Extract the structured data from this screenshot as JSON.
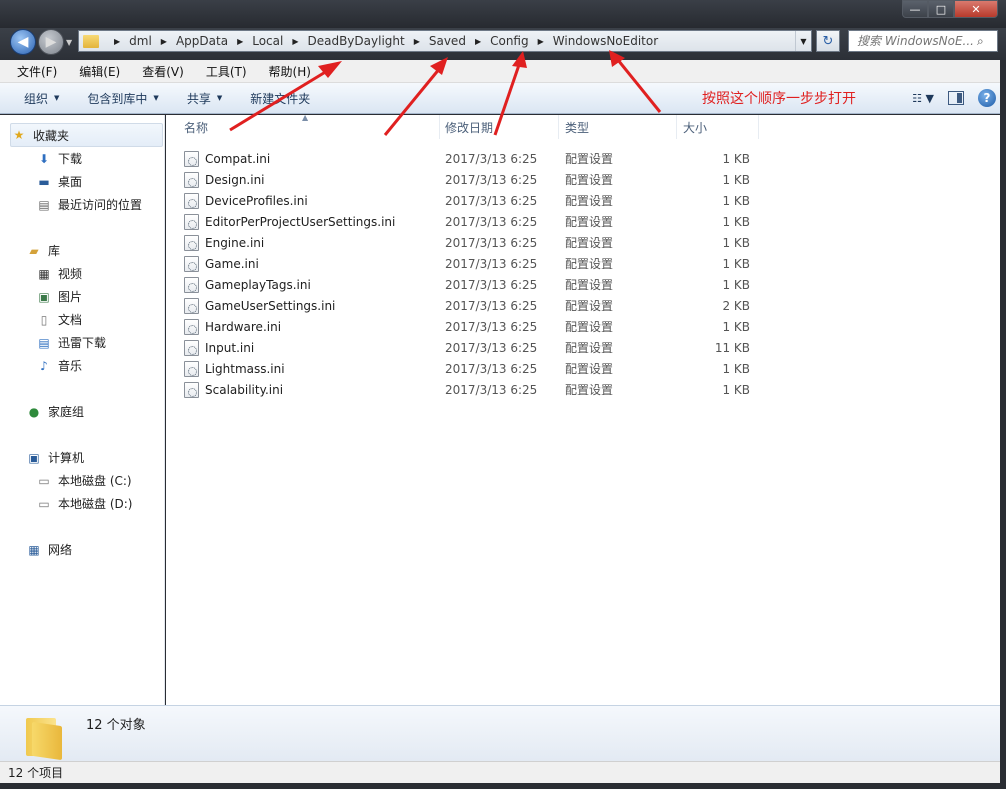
{
  "window": {
    "minimize": "—",
    "maximize": "□",
    "close": "✕"
  },
  "nav": {
    "back": "◀",
    "forward": "▶"
  },
  "breadcrumbs": [
    "dml",
    "AppData",
    "Local",
    "DeadByDaylight",
    "Saved",
    "Config",
    "WindowsNoEditor"
  ],
  "search": {
    "placeholder": "搜索 WindowsNoE..."
  },
  "menu": [
    "文件(F)",
    "编辑(E)",
    "查看(V)",
    "工具(T)",
    "帮助(H)"
  ],
  "toolbar": {
    "organize": "组织",
    "include_in_library": "包含到库中",
    "share": "共享",
    "new_folder": "新建文件夹"
  },
  "annotation": "按照这个顺序一步步打开",
  "sidebar": {
    "favorites": "收藏夹",
    "downloads": "下载",
    "desktop": "桌面",
    "recent": "最近访问的位置",
    "libraries": "库",
    "videos": "视频",
    "pictures": "图片",
    "documents": "文档",
    "thunder": "迅雷下载",
    "music": "音乐",
    "homegroup": "家庭组",
    "computer": "计算机",
    "drive_c": "本地磁盘 (C:)",
    "drive_d": "本地磁盘 (D:)",
    "network": "网络"
  },
  "columns": {
    "name": "名称",
    "date": "修改日期",
    "type": "类型",
    "size": "大小"
  },
  "files": [
    {
      "name": "Compat.ini",
      "date": "2017/3/13 6:25",
      "type": "配置设置",
      "size": "1 KB"
    },
    {
      "name": "Design.ini",
      "date": "2017/3/13 6:25",
      "type": "配置设置",
      "size": "1 KB"
    },
    {
      "name": "DeviceProfiles.ini",
      "date": "2017/3/13 6:25",
      "type": "配置设置",
      "size": "1 KB"
    },
    {
      "name": "EditorPerProjectUserSettings.ini",
      "date": "2017/3/13 6:25",
      "type": "配置设置",
      "size": "1 KB"
    },
    {
      "name": "Engine.ini",
      "date": "2017/3/13 6:25",
      "type": "配置设置",
      "size": "1 KB"
    },
    {
      "name": "Game.ini",
      "date": "2017/3/13 6:25",
      "type": "配置设置",
      "size": "1 KB"
    },
    {
      "name": "GameplayTags.ini",
      "date": "2017/3/13 6:25",
      "type": "配置设置",
      "size": "1 KB"
    },
    {
      "name": "GameUserSettings.ini",
      "date": "2017/3/13 6:25",
      "type": "配置设置",
      "size": "2 KB"
    },
    {
      "name": "Hardware.ini",
      "date": "2017/3/13 6:25",
      "type": "配置设置",
      "size": "1 KB"
    },
    {
      "name": "Input.ini",
      "date": "2017/3/13 6:25",
      "type": "配置设置",
      "size": "11 KB"
    },
    {
      "name": "Lightmass.ini",
      "date": "2017/3/13 6:25",
      "type": "配置设置",
      "size": "1 KB"
    },
    {
      "name": "Scalability.ini",
      "date": "2017/3/13 6:25",
      "type": "配置设置",
      "size": "1 KB"
    }
  ],
  "details": {
    "count": "12 个对象"
  },
  "status": {
    "items": "12 个项目"
  },
  "colors": {
    "annotation": "#e02020",
    "selection": "#e4edf8",
    "toolbar_text": "#1e395b"
  }
}
